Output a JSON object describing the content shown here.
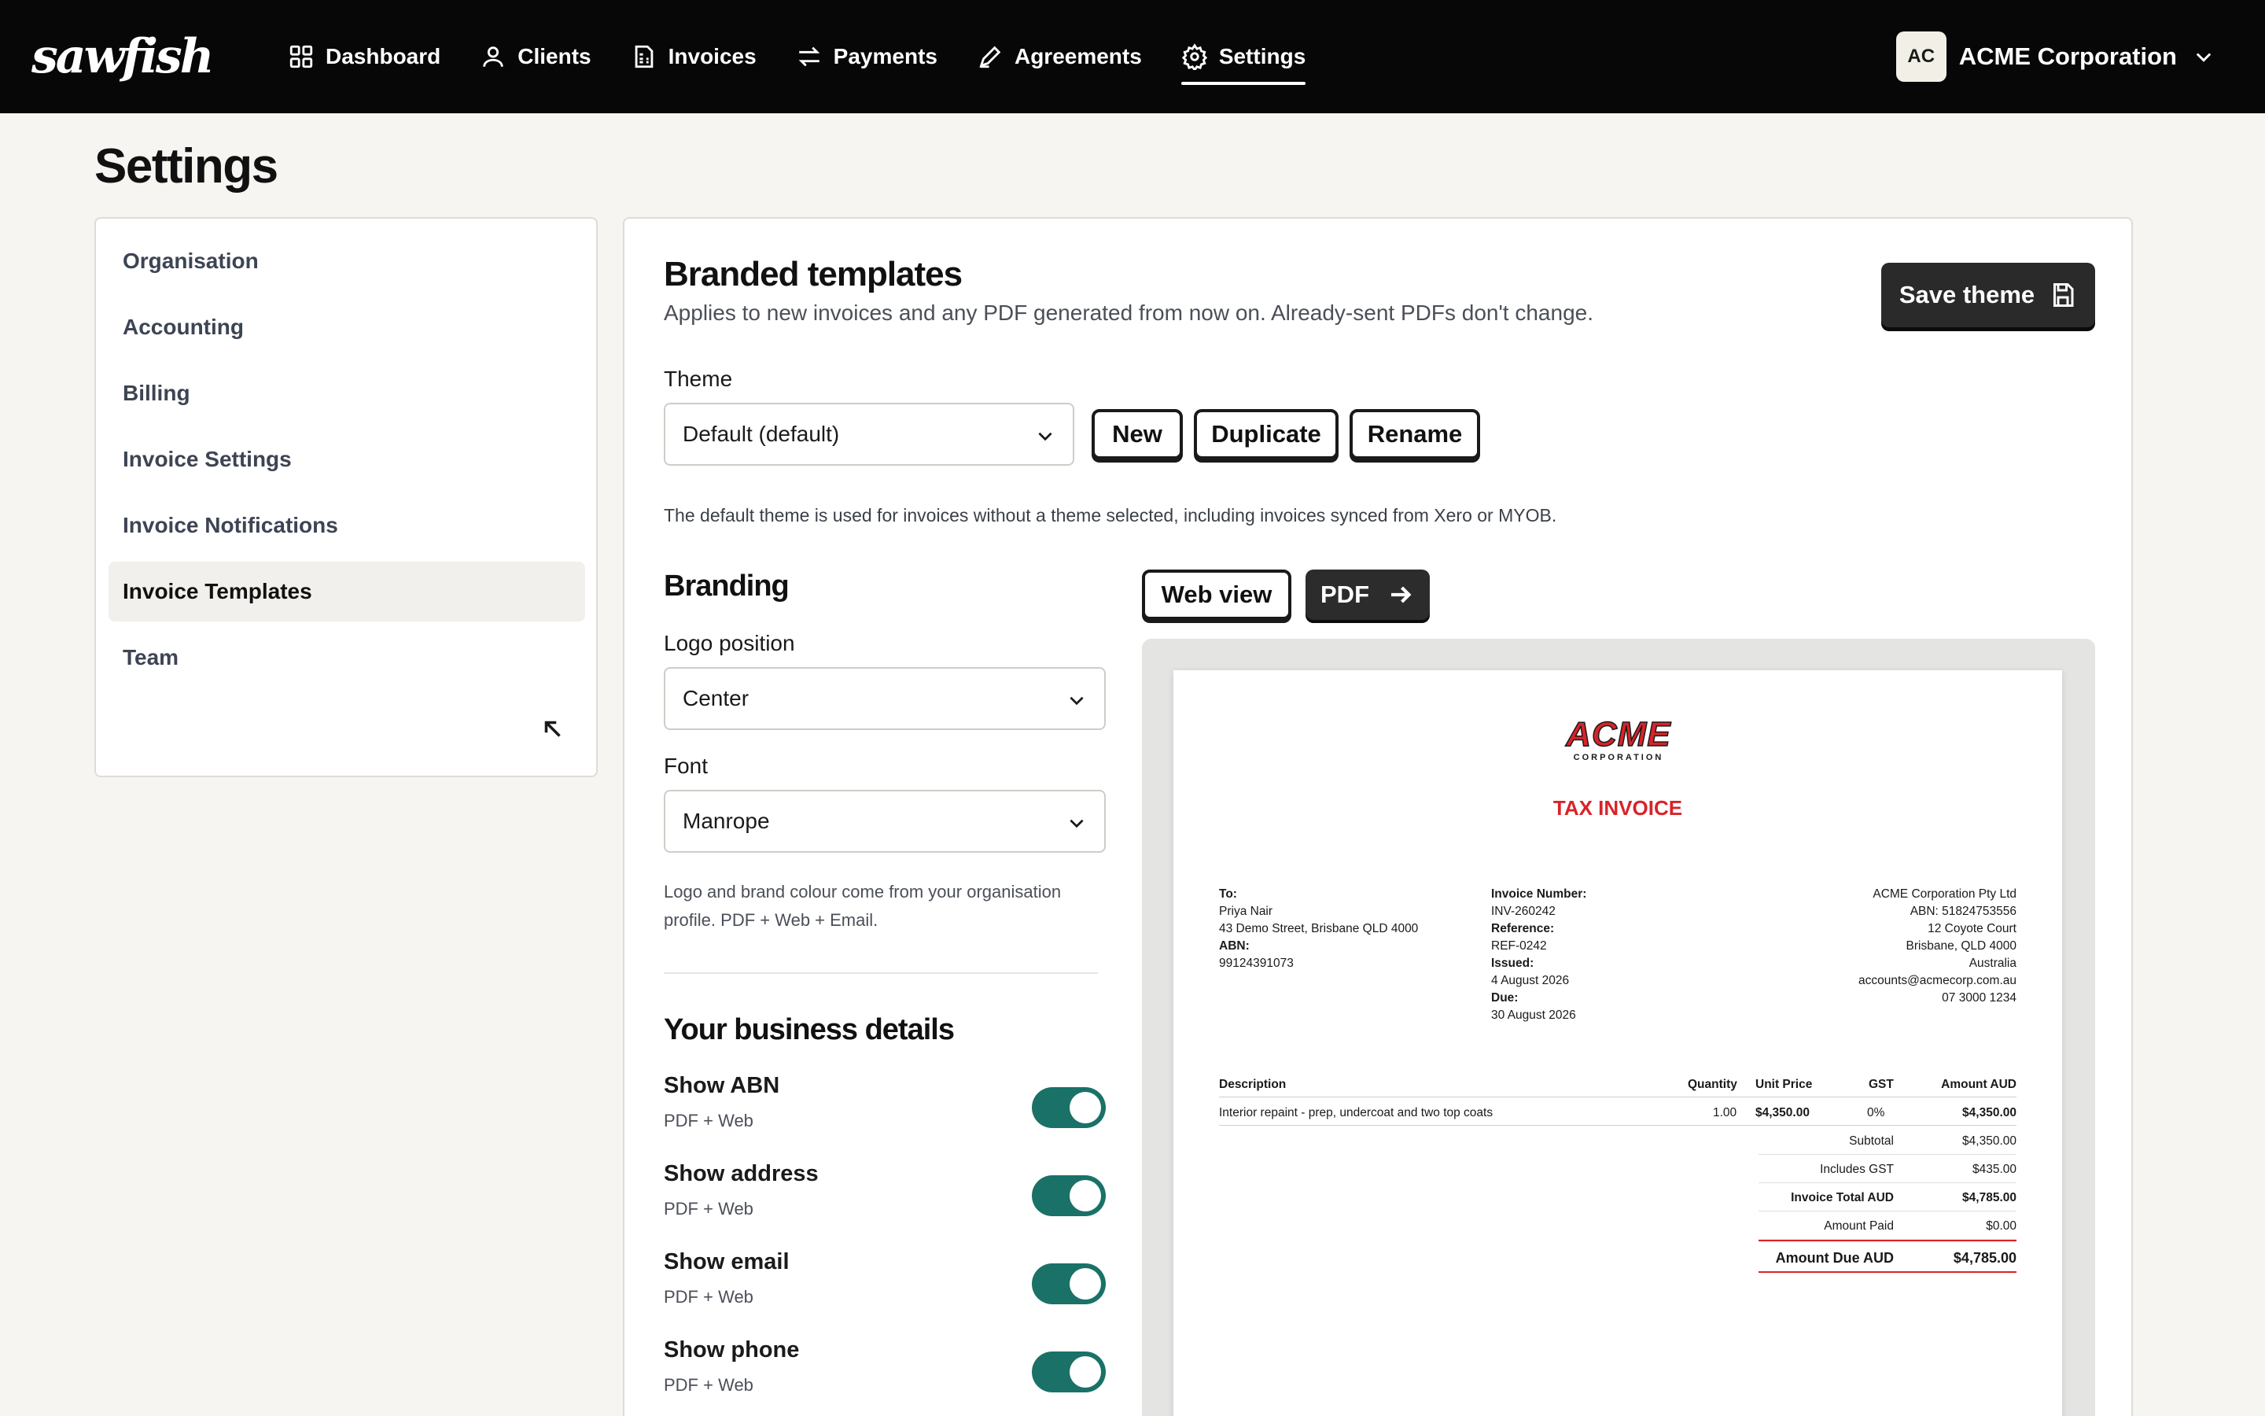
{
  "app": {
    "brand": "sawfish"
  },
  "nav": {
    "items": [
      {
        "label": "Dashboard",
        "icon": "grid-icon"
      },
      {
        "label": "Clients",
        "icon": "user-icon"
      },
      {
        "label": "Invoices",
        "icon": "invoice-icon"
      },
      {
        "label": "Payments",
        "icon": "arrows-icon"
      },
      {
        "label": "Agreements",
        "icon": "pen-icon"
      },
      {
        "label": "Settings",
        "icon": "gear-icon"
      }
    ],
    "active": "Settings"
  },
  "org": {
    "initials": "AC",
    "name": "ACME Corporation"
  },
  "page": {
    "title": "Settings"
  },
  "sidemenu": {
    "items": [
      {
        "label": "Organisation"
      },
      {
        "label": "Accounting"
      },
      {
        "label": "Billing"
      },
      {
        "label": "Invoice Settings"
      },
      {
        "label": "Invoice Notifications"
      },
      {
        "label": "Invoice Templates"
      },
      {
        "label": "Team"
      }
    ],
    "active": "Invoice Templates"
  },
  "templates": {
    "title": "Branded templates",
    "subtitle": "Applies to new invoices and any PDF generated from now on. Already-sent PDFs don't change.",
    "save_label": "Save theme",
    "theme_label": "Theme",
    "theme_value": "Default (default)",
    "new_label": "New",
    "duplicate_label": "Duplicate",
    "rename_label": "Rename",
    "theme_note": "The default theme is used for invoices without a theme selected, including invoices synced from Xero or MYOB."
  },
  "branding": {
    "title": "Branding",
    "logo_position_label": "Logo position",
    "logo_position_value": "Center",
    "font_label": "Font",
    "font_value": "Manrope",
    "note_line1": "Logo and brand colour come from your organisation",
    "note_line2": "profile. PDF + Web + Email."
  },
  "business": {
    "title": "Your business details",
    "toggles": [
      {
        "label": "Show ABN",
        "sub": "PDF + Web",
        "on": true
      },
      {
        "label": "Show address",
        "sub": "PDF + Web",
        "on": true
      },
      {
        "label": "Show email",
        "sub": "PDF + Web",
        "on": true
      },
      {
        "label": "Show phone",
        "sub": "PDF + Web",
        "on": true
      }
    ]
  },
  "preview": {
    "web_view_label": "Web view",
    "pdf_label": "PDF",
    "invoice": {
      "logo_word": "ACME",
      "logo_sub": "CORPORATION",
      "title": "TAX INVOICE",
      "to_label": "To:",
      "to_name": "Priya Nair",
      "to_address": "43 Demo Street, Brisbane QLD 4000",
      "abn_label": "ABN:",
      "abn_value": "99124391073",
      "invoice_number_label": "Invoice Number:",
      "invoice_number": "INV-260242",
      "reference_label": "Reference:",
      "reference": "REF-0242",
      "issued_label": "Issued:",
      "issued": "4 August 2026",
      "due_label": "Due:",
      "due": "30 August 2026",
      "from": [
        "ACME Corporation Pty Ltd",
        "ABN: 51824753556",
        "12 Coyote Court",
        "Brisbane, QLD 4000",
        "Australia",
        "accounts@acmecorp.com.au",
        "07 3000 1234"
      ],
      "columns": [
        "Description",
        "Quantity",
        "Unit Price",
        "GST",
        "Amount AUD"
      ],
      "line": {
        "description": "Interior repaint - prep, undercoat and two top coats",
        "quantity": "1.00",
        "unit_price": "$4,350.00",
        "gst": "0%",
        "amount": "$4,350.00"
      },
      "totals": [
        {
          "label": "Subtotal",
          "value": "$4,350.00"
        },
        {
          "label": "Includes GST",
          "value": "$435.00"
        },
        {
          "label": "Invoice Total AUD",
          "value": "$4,785.00"
        },
        {
          "label": "Amount Paid",
          "value": "$0.00"
        },
        {
          "label": "Amount Due AUD",
          "value": "$4,785.00"
        }
      ]
    }
  },
  "colors": {
    "topbar": "#070707",
    "toggle_on": "#1a7168",
    "brand_red": "#d8232a"
  }
}
